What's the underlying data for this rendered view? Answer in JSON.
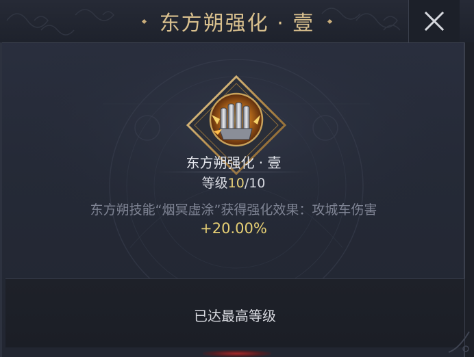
{
  "header": {
    "title": "东方朔强化 · 壹"
  },
  "close": {
    "icon": "close-icon"
  },
  "skill": {
    "name": "东方朔强化 · 壹",
    "level_label": "等级",
    "level_current": "10",
    "level_max": "/10",
    "description": "东方朔技能“烟冥虚涂”获得强化效果：攻城车伤害",
    "bonus": "+20.00%",
    "icon": "siege-gauntlet-icon"
  },
  "footer": {
    "status": "已达最高等级"
  },
  "colors": {
    "title_gold": "#d9c08e",
    "level_gold": "#e9d27a",
    "bonus_gold": "#e6cf74",
    "desc_gray": "#7f8494"
  }
}
